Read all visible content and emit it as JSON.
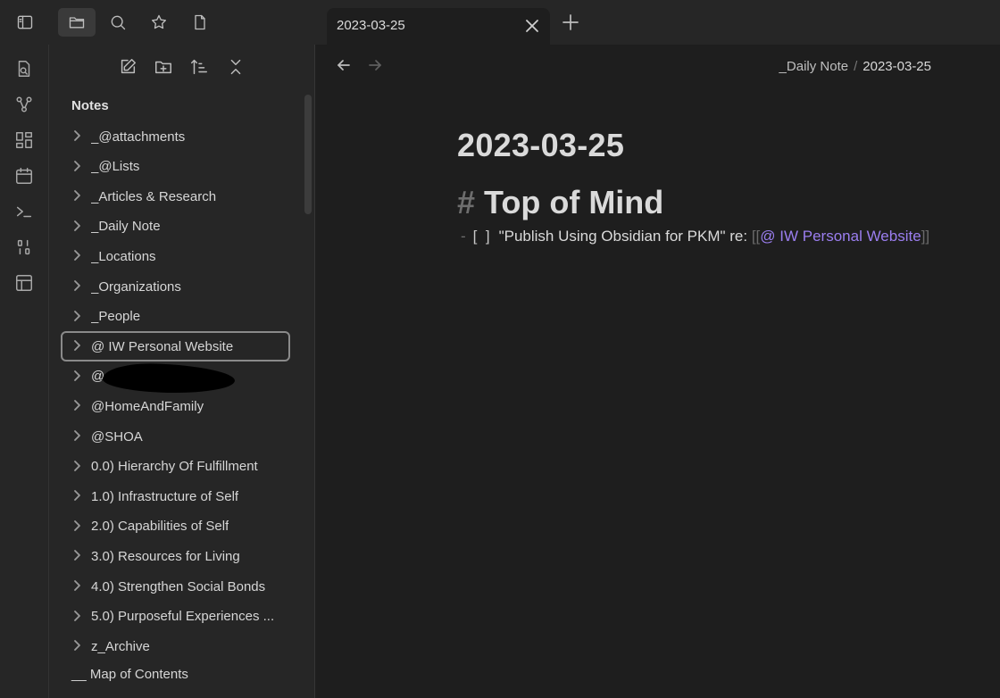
{
  "tab": {
    "title": "2023-03-25"
  },
  "sidebar": {
    "vault_name": "Notes",
    "items": [
      {
        "label": "_@attachments"
      },
      {
        "label": "_@Lists"
      },
      {
        "label": "_Articles & Research"
      },
      {
        "label": "_Daily Note"
      },
      {
        "label": "_Locations"
      },
      {
        "label": "_Organizations"
      },
      {
        "label": "_People"
      },
      {
        "label": "@ IW Personal Website",
        "focused": true
      },
      {
        "label": "@"
      },
      {
        "label": "@HomeAndFamily"
      },
      {
        "label": "@SHOA"
      },
      {
        "label": "0.0) Hierarchy Of Fulfillment"
      },
      {
        "label": "1.0) Infrastructure of Self"
      },
      {
        "label": "2.0) Capabilities of Self"
      },
      {
        "label": "3.0) Resources for Living"
      },
      {
        "label": "4.0) Strengthen Social Bonds"
      },
      {
        "label": "5.0) Purposeful Experiences ..."
      },
      {
        "label": "z_Archive"
      }
    ],
    "file_item": "__ Map of Contents"
  },
  "breadcrumb": {
    "folder": "_Daily Note",
    "separator": "/",
    "current": "2023-03-25"
  },
  "note": {
    "title": "2023-03-25",
    "heading_marker": "#",
    "heading": "Top of Mind",
    "task": {
      "dash": "-",
      "checkbox": "[  ]",
      "text": "\"Publish Using Obsidian for PKM\" re: ",
      "link_open": "[[",
      "link_text": "@ IW Personal Website",
      "link_close": "]]"
    }
  },
  "colors": {
    "accent_link": "#9b7ef0",
    "background": "#1e1e1e",
    "panel": "#262626"
  }
}
